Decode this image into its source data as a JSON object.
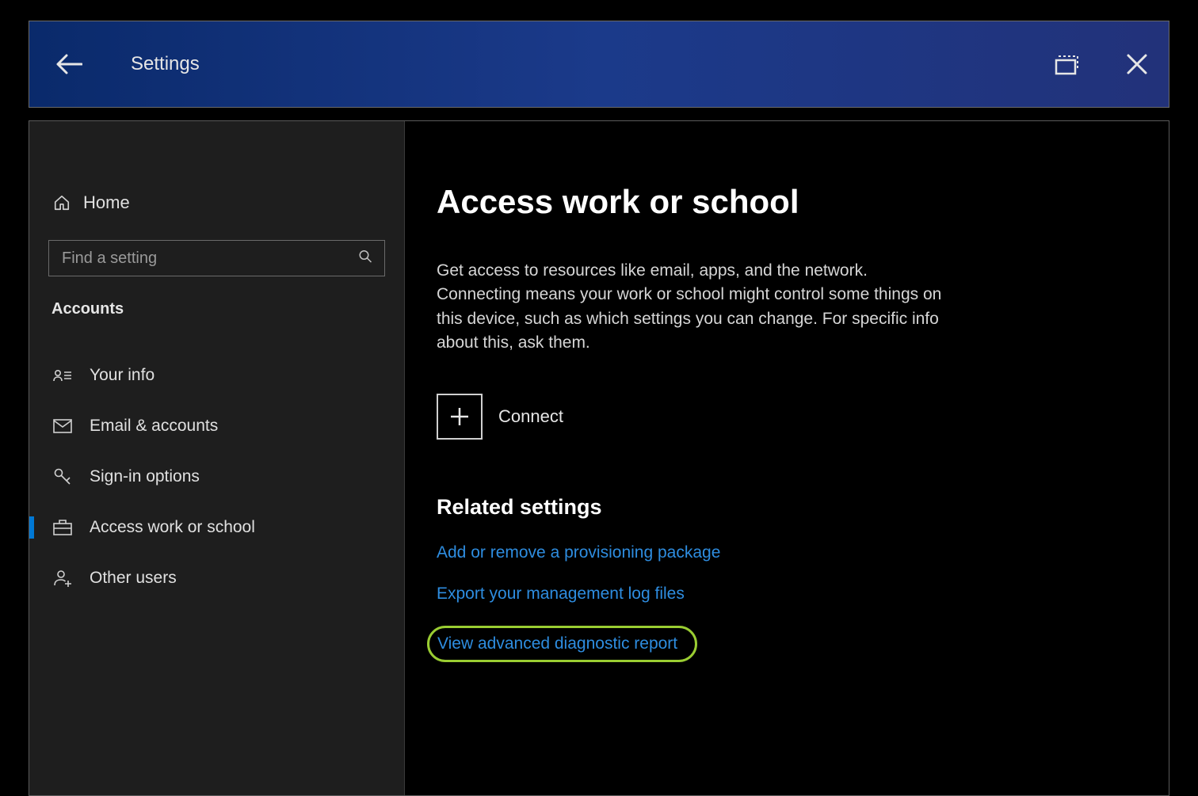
{
  "titlebar": {
    "title": "Settings"
  },
  "sidebar": {
    "home": "Home",
    "search_placeholder": "Find a setting",
    "section": "Accounts",
    "items": {
      "your_info": "Your info",
      "email_accounts": "Email & accounts",
      "signin_options": "Sign-in options",
      "access_work_school": "Access work or school",
      "other_users": "Other users"
    }
  },
  "main": {
    "title": "Access work or school",
    "description": "Get access to resources like email, apps, and the network. Connecting means your work or school might control some things on this device, such as which settings you can change. For specific info about this, ask them.",
    "connect_label": "Connect",
    "related_title": "Related settings",
    "links": {
      "provisioning": "Add or remove a provisioning package",
      "export_logs": "Export your management log files",
      "diagnostic": "View advanced diagnostic report"
    }
  }
}
